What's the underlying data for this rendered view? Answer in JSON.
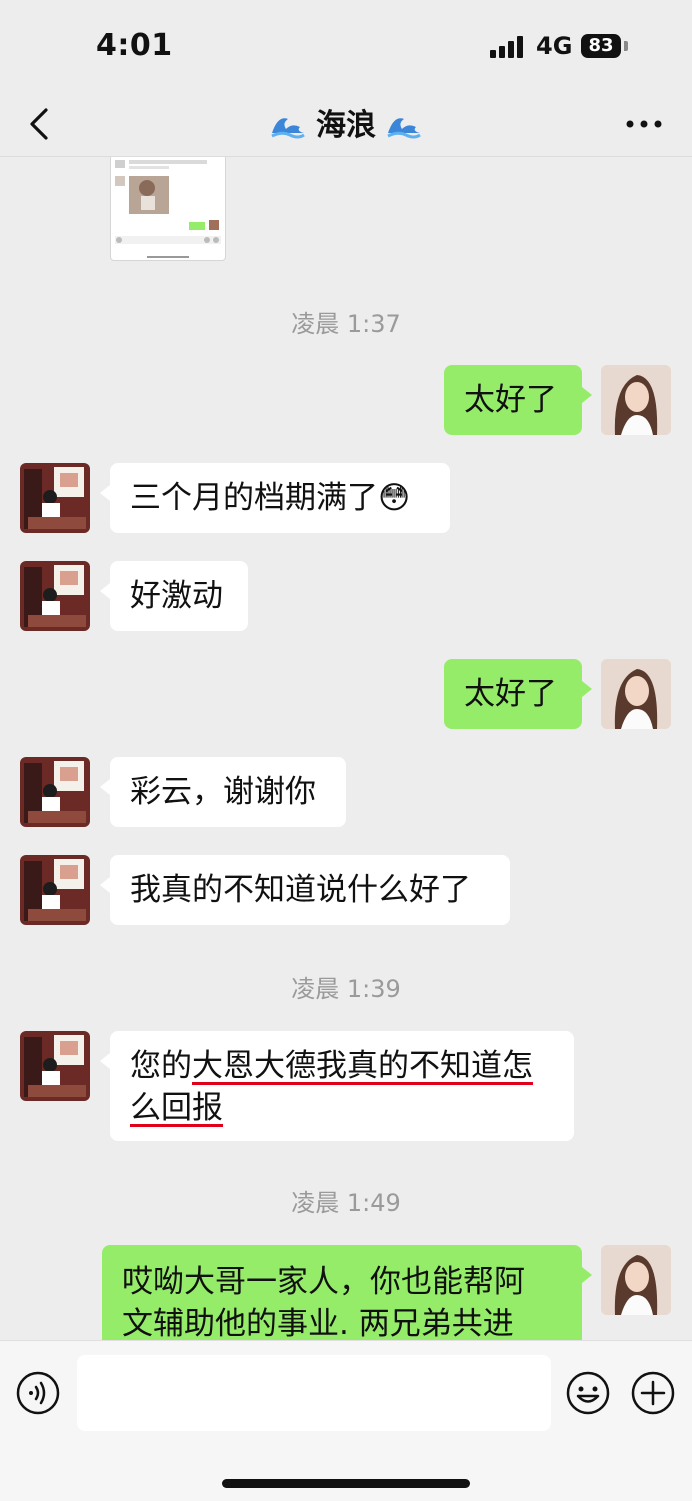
{
  "status_bar": {
    "time": "4:01",
    "network": "4G",
    "battery": "83"
  },
  "header": {
    "title": "海浪",
    "back_icon": "chevron-left-icon",
    "more_icon": "more-dots-icon"
  },
  "messages": [
    {
      "type": "timestamp",
      "text": "凌晨 1:37"
    },
    {
      "type": "message",
      "side": "out",
      "text": "太好了"
    },
    {
      "type": "message",
      "side": "in",
      "text": "三个月的档期满了",
      "emoji": "😳"
    },
    {
      "type": "message",
      "side": "in",
      "text": "好激动"
    },
    {
      "type": "message",
      "side": "out",
      "text": "太好了"
    },
    {
      "type": "message",
      "side": "in",
      "text": "彩云，谢谢你"
    },
    {
      "type": "message",
      "side": "in",
      "text": "我真的不知道说什么好了"
    },
    {
      "type": "timestamp",
      "text": "凌晨 1:39"
    },
    {
      "type": "message",
      "side": "in",
      "prefix": "您的",
      "highlight": "大恩大德我真的不知道怎么回报"
    },
    {
      "type": "timestamp",
      "text": "凌晨 1:49"
    },
    {
      "type": "message",
      "side": "out",
      "lines": [
        "哎呦大哥一家人，你也能帮阿",
        "文辅助他的事业. 两兄弟共进"
      ]
    }
  ],
  "input_bar": {
    "input_value": "",
    "voice_icon": "voice-icon",
    "emoji_icon": "emoji-icon",
    "plus_icon": "plus-icon"
  },
  "colors": {
    "background": "#ededed",
    "outgoing_bubble": "#95ec69",
    "incoming_bubble": "#ffffff",
    "timestamp_text": "#9a9a9a",
    "underline": "#e0001b"
  }
}
